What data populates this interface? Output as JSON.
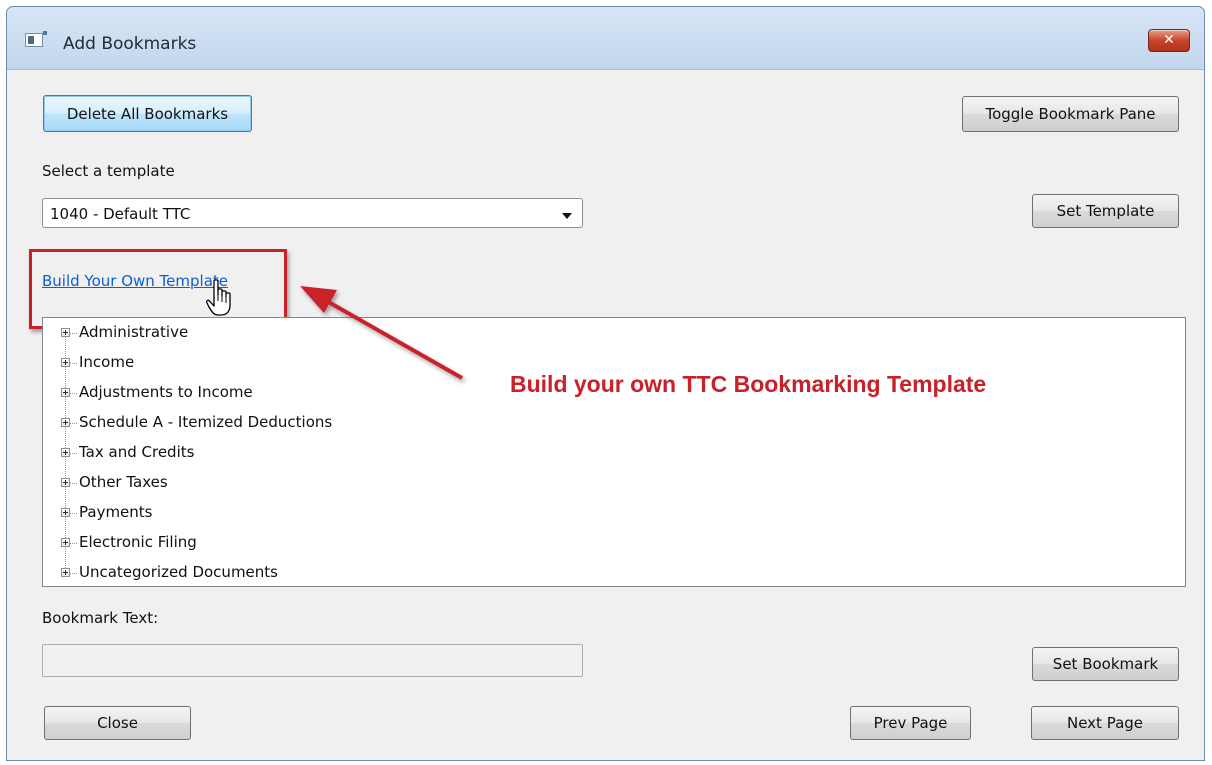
{
  "window": {
    "title": "Add Bookmarks",
    "close_glyph": "✕"
  },
  "buttons": {
    "delete_all": "Delete All Bookmarks",
    "toggle_pane": "Toggle Bookmark Pane",
    "set_template": "Set Template",
    "set_bookmark": "Set Bookmark",
    "close": "Close",
    "prev_page": "Prev Page",
    "next_page": "Next Page"
  },
  "template": {
    "label": "Select a template",
    "selected": "1040 - Default TTC",
    "build_link": "Build Your Own Template"
  },
  "tree": {
    "items": [
      {
        "label": "Administrative"
      },
      {
        "label": "Income"
      },
      {
        "label": "Adjustments to Income"
      },
      {
        "label": "Schedule A - Itemized Deductions"
      },
      {
        "label": "Tax and Credits"
      },
      {
        "label": "Other Taxes"
      },
      {
        "label": "Payments"
      },
      {
        "label": "Electronic Filing"
      },
      {
        "label": "Uncategorized Documents"
      }
    ]
  },
  "bookmark": {
    "label": "Bookmark Text:",
    "value": ""
  },
  "annotation": {
    "text": "Build your own TTC Bookmarking Template",
    "color": "#c9202a"
  },
  "icons": {
    "app": "app-window-icon",
    "cursor": "hand-pointer-icon",
    "expander": "plus-expander-icon"
  }
}
